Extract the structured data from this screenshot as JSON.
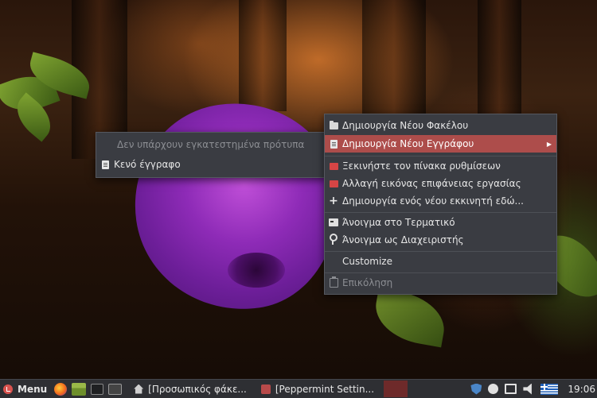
{
  "submenu": {
    "items": [
      {
        "label": "Δεν υπάρχουν εγκατεστημένα πρότυπα",
        "icon": "",
        "disabled": true
      },
      {
        "label": "Κενό έγγραφο",
        "icon": "document-icon",
        "disabled": false
      }
    ]
  },
  "context_menu": {
    "items": [
      {
        "label": "Δημιουργία Νέου Φακέλου",
        "icon": "folder-icon"
      },
      {
        "label": "Δημιουργία Νέου Εγγράφου",
        "icon": "document-icon",
        "active": true,
        "has_submenu": true,
        "submenu_arrow": "▶"
      },
      {
        "label": "Ξεκινήστε τον πίνακα ρυθμίσεων",
        "icon": "settings-flag-icon"
      },
      {
        "label": "Αλλαγή εικόνας επιφάνειας εργασίας",
        "icon": "wallpaper-flag-icon"
      },
      {
        "label": "Δημιουργία ενός νέου εκκινητή εδώ...",
        "icon": "plus-icon"
      },
      {
        "label": "Άνοιγμα στο Τερματικό",
        "icon": "terminal-icon"
      },
      {
        "label": "Άνοιγμα ως Διαχειριστής",
        "icon": "key-icon"
      },
      {
        "label": "Customize",
        "icon": ""
      },
      {
        "label": "Επικόληση",
        "icon": "paste-icon",
        "disabled": true
      }
    ],
    "active_color": "#ad4d4b"
  },
  "taskbar": {
    "menu_label": "Menu",
    "windows": [
      {
        "label": "[Προσωπικός φάκε...",
        "icon": "home-folder-icon"
      },
      {
        "label": "[Peppermint Settin...",
        "icon": "settings-app-icon"
      }
    ],
    "clock": "19:06",
    "keyboard_layout_flag": "greek-flag-icon"
  }
}
